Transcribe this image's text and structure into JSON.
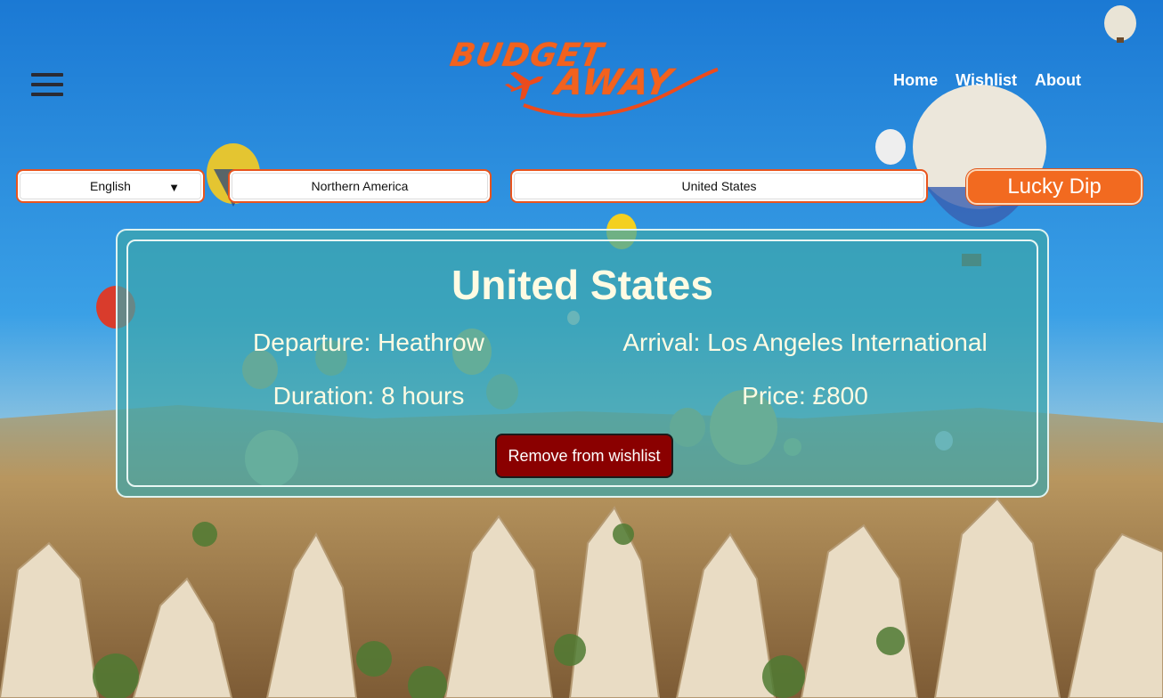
{
  "header": {
    "logo": {
      "line1": "BUDGET",
      "line2": "AWAY"
    },
    "nav": [
      {
        "label": "Home"
      },
      {
        "label": "Wishlist"
      },
      {
        "label": "About"
      }
    ]
  },
  "controls": {
    "language": {
      "value": "English"
    },
    "region": {
      "value": "Northern America"
    },
    "country": {
      "value": "United States"
    },
    "lucky_dip_label": "Lucky Dip"
  },
  "card": {
    "title": "United States",
    "departure": "Departure: Heathrow",
    "arrival": "Arrival: Los Angeles International",
    "duration": "Duration: 8 hours",
    "price": "Price: £800",
    "remove_label": "Remove from wishlist"
  },
  "colors": {
    "accent": "#f26a20",
    "remove_button": "#8a0000",
    "card_bg": "#3ca5aa"
  },
  "icons": [
    "hamburger-menu-icon",
    "airplane-icon",
    "dropdown-caret-icon"
  ]
}
